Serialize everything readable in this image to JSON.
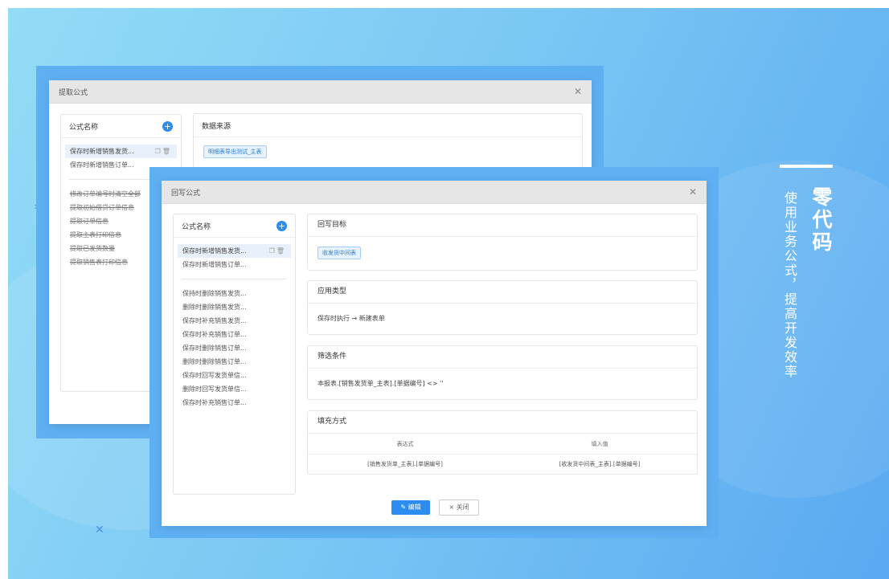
{
  "extract_dialog": {
    "title": "提取公式",
    "formula_list_header": "公式名称",
    "selected_item": "保存时新增销售发货...",
    "items_top": [
      "保存时新增销售订单..."
    ],
    "items_bottom": [
      "修改订单编号时清空全部",
      "提取初始借贷订单信息",
      "提取订单信息",
      "提取主表打印信息",
      "提取已发货数量",
      "提取销售表打印信息"
    ],
    "datasource_header": "数据来源",
    "datasource_tag": "明细表导出测试_主表"
  },
  "writeback_dialog": {
    "title": "回写公式",
    "formula_list_header": "公式名称",
    "selected_item": "保存时新增销售发货...",
    "items_top": [
      "保存时新增销售订单..."
    ],
    "items_bottom": [
      "保持时删除销售发货...",
      "删除时删除销售发货...",
      "保存时补充销售发货...",
      "保存时补充销售订单...",
      "保存时删除销售订单...",
      "删除时删除销售订单...",
      "保存时回写发货单信...",
      "删除时回写发货单信...",
      "保存时补充销售订单..."
    ],
    "target_header": "回写目标",
    "target_tag": "收发货中间表",
    "apply_header": "应用类型",
    "apply_value": "保存时执行 → 新建表单",
    "filter_header": "筛选条件",
    "filter_value": "本报表.[销售发货单_主表].[单据编号] <> ''",
    "fill_header": "填充方式",
    "table_headers": [
      "表达式",
      "填入值"
    ],
    "table_row": [
      "[销售发货单_主表].[单据编号]",
      "[收发货中间表_主表].[单据编号]"
    ],
    "edit_button": "✎ 编辑",
    "close_button": "× 关闭"
  },
  "side_title": "零代码",
  "side_subtitle": "使用业务公式，提高开发效率"
}
